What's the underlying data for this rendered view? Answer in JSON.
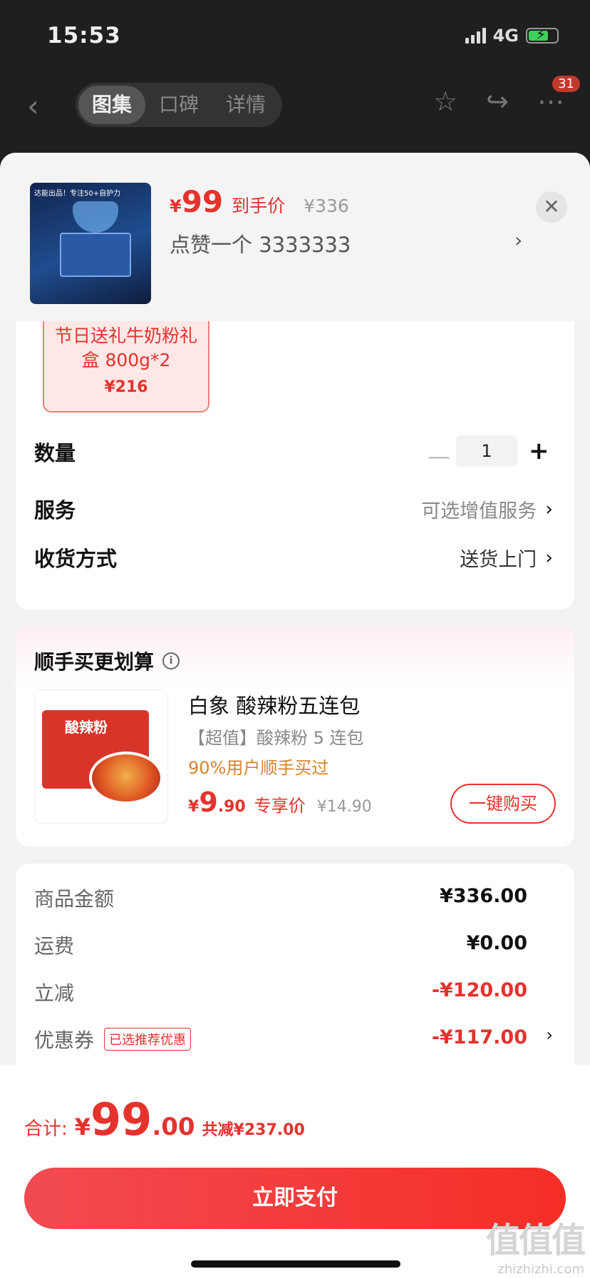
{
  "status_bar": {
    "time": "15:53",
    "network": "4G"
  },
  "nav": {
    "tabs": [
      {
        "label": "图集",
        "active": true
      },
      {
        "label": "口碑",
        "active": false
      },
      {
        "label": "详情",
        "active": false
      }
    ],
    "badge_count": "31"
  },
  "product_header": {
    "thumb_caption": "达能出品！专注50+自护力",
    "price_symbol": "¥",
    "price": "99",
    "price_label": "到手价",
    "original_price": "¥336",
    "subtitle": "点赞一个  3333333"
  },
  "spec": {
    "selected_name": "节日送礼牛奶粉礼盒 800g*2",
    "selected_price": "¥216"
  },
  "options": {
    "quantity_label": "数量",
    "quantity_value": "1",
    "service_label": "服务",
    "service_value": "可选增值服务",
    "delivery_label": "收货方式",
    "delivery_value": "送货上门"
  },
  "addon": {
    "title": "顺手买更划算",
    "product_name": "白象 酸辣粉五连包",
    "description": "【超值】酸辣粉 5 连包",
    "stat": "90%用户顺手买过",
    "price_symbol": "¥",
    "price_int": "9",
    "price_dec": ".90",
    "price_label": "专享价",
    "original_price": "¥14.90",
    "buy_button": "一键购买",
    "thumb_logo": "酸辣粉"
  },
  "summary": {
    "rows": [
      {
        "label": "商品金额",
        "value": "¥336.00"
      },
      {
        "label": "运费",
        "value": "¥0.00"
      },
      {
        "label": "立减",
        "value": "-¥120.00"
      },
      {
        "label": "优惠券",
        "value": "-¥117.00",
        "tag": "已选推荐优惠"
      }
    ]
  },
  "bottom": {
    "total_label": "合计:",
    "total_symbol": "¥",
    "total_int": "99",
    "total_dec": ".00",
    "saved_text": "共减¥237.00",
    "pay_button": "立即支付"
  },
  "watermark": {
    "mark": "值值值",
    "site": "zhizhizhi.com"
  },
  "colors": {
    "accent": "#e5322d",
    "pay_start": "#f24a52",
    "pay_end": "#f52e26"
  }
}
